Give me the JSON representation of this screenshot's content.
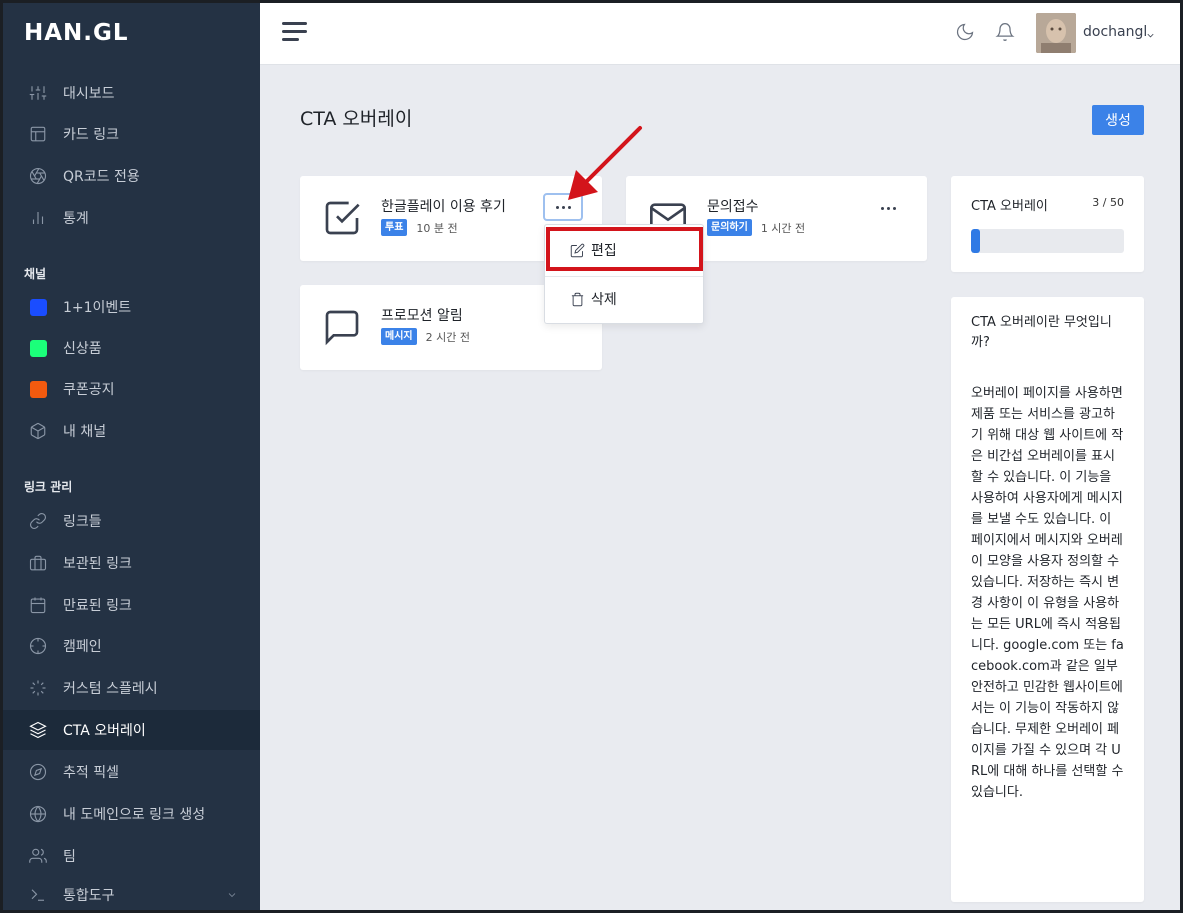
{
  "app": {
    "logo": "HAN.GL"
  },
  "sidebar": {
    "items": [
      {
        "label": "대시보드",
        "icon": "sliders-icon"
      },
      {
        "label": "카드 링크",
        "icon": "layout-icon"
      },
      {
        "label": "QR코드 전용",
        "icon": "aperture-icon"
      },
      {
        "label": "통계",
        "icon": "bar-chart-icon"
      }
    ],
    "channels_title": "채널",
    "channels": [
      {
        "label": "1+1이벤트",
        "color": "#1a4dff"
      },
      {
        "label": "신상품",
        "color": "#1bff7a"
      },
      {
        "label": "쿠폰공지",
        "color": "#f25a0f"
      },
      {
        "label": "내 채널",
        "icon": "box-icon"
      }
    ],
    "links_title": "링크 관리",
    "link_items": [
      {
        "label": "링크들",
        "icon": "link-icon"
      },
      {
        "label": "보관된 링크",
        "icon": "briefcase-icon"
      },
      {
        "label": "만료된 링크",
        "icon": "calendar-icon"
      },
      {
        "label": "캠페인",
        "icon": "crosshair-icon"
      },
      {
        "label": "커스텀 스플레시",
        "icon": "loader-icon"
      },
      {
        "label": "CTA 오버레이",
        "icon": "layers-icon",
        "active": true
      },
      {
        "label": "추적 픽셀",
        "icon": "compass-icon"
      },
      {
        "label": "내 도메인으로 링크 생성",
        "icon": "globe-icon"
      },
      {
        "label": "팀",
        "icon": "users-icon"
      },
      {
        "label": "통합도구",
        "icon": "terminal-icon"
      }
    ]
  },
  "header": {
    "username": "dochangl"
  },
  "main": {
    "title": "CTA 오버레이",
    "create_label": "생성",
    "cards": [
      {
        "title": "한글플레이 이용 후기",
        "badge": "투표",
        "time": "10 분 전",
        "icon": "check-square-icon"
      },
      {
        "title": "문의접수",
        "badge": "문의하기",
        "time": "1 시간 전",
        "icon": "mail-icon"
      },
      {
        "title": "프로모션 알림",
        "badge": "메시지",
        "time": "2 시간 전",
        "icon": "message-square-icon"
      }
    ],
    "menu": {
      "edit": "편집",
      "delete": "삭제"
    }
  },
  "stats": {
    "label": "CTA 오버레이",
    "count": "3 / 50",
    "usage_fraction": 0.06
  },
  "info": {
    "title": "CTA 오버레이란 무엇입니까?",
    "body": "오버레이 페이지를 사용하면 제품 또는 서비스를 광고하기 위해 대상 웹 사이트에 작은 비간섭 오버레이를 표시할 수 있습니다. 이 기능을 사용하여 사용자에게 메시지를 보낼 수도 있습니다. 이 페이지에서 메시지와 오버레이 모양을 사용자 정의할 수 있습니다. 저장하는 즉시 변경 사항이 이 유형을 사용하는 모든 URL에 즉시 적용됩니다. google.com 또는 facebook.com과 같은 일부 안전하고 민감한 웹사이트에서는 이 기능이 작동하지 않습니다. 무제한 오버레이 페이지를 가질 수 있으며 각 URL에 대해 하나를 선택할 수 있습니다."
  },
  "colors": {
    "accent": "#3b82e8",
    "sidebar": "#243244",
    "highlight": "#d3141b"
  }
}
